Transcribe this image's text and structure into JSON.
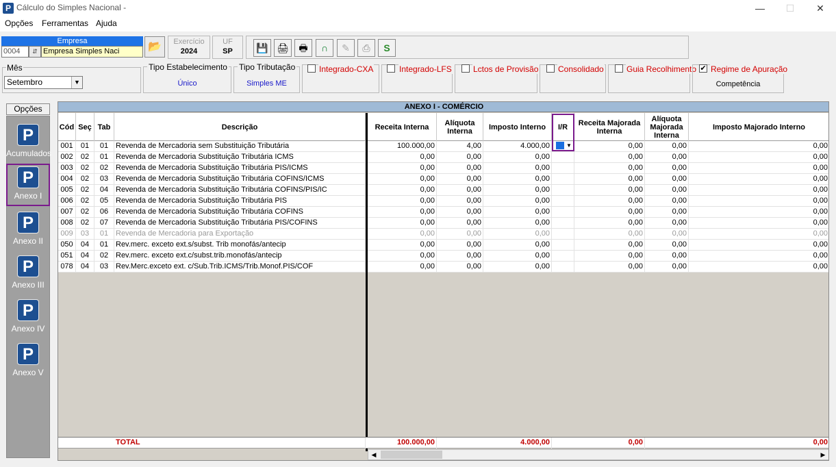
{
  "window": {
    "title": "Cálculo do Simples Nacional -",
    "minimize": "—",
    "maximize": "☐",
    "close": "✕"
  },
  "menu": [
    "Opções",
    "Ferramentas",
    "Ajuda"
  ],
  "empresa": {
    "header": "Empresa",
    "code": "0004",
    "name": "Empresa Simples Naci"
  },
  "exercicio": {
    "label": "Exercício",
    "value": "2024"
  },
  "uf": {
    "label": "UF",
    "value": "SP"
  },
  "tools": [
    "save-icon",
    "print-icon",
    "print-preview-icon",
    "magnet-icon",
    "disabled-icon",
    "scanner-icon",
    "refresh-icon"
  ],
  "filters": {
    "mes": {
      "label": "Mês",
      "value": "Setembro"
    },
    "tipo_estabelecimento": {
      "label": "Tipo Estabelecimento",
      "value": "Único"
    },
    "tipo_tributacao": {
      "label": "Tipo Tributação",
      "value": "Simples ME"
    },
    "checks": [
      {
        "label": "Integrado-CXA",
        "checked": false
      },
      {
        "label": "Integrado-LFS",
        "checked": false
      },
      {
        "label": "Lctos de Provisão",
        "checked": false
      },
      {
        "label": "Consolidado",
        "checked": false
      },
      {
        "label": "Guia Recolhimento",
        "checked": false
      },
      {
        "label": "Regime de Apuração",
        "checked": true,
        "value": "Competência"
      }
    ]
  },
  "nav": {
    "title": "Opções",
    "items": [
      "Acumulados",
      "Anexo I",
      "Anexo II",
      "Anexo III",
      "Anexo IV",
      "Anexo V"
    ],
    "selected": "Anexo I"
  },
  "grid": {
    "title": "ANEXO I - COMÉRCIO",
    "headers": {
      "cod": "Cód",
      "sec": "Seç",
      "tab": "Tab",
      "descricao": "Descrição",
      "receita_interna": "Receita Interna",
      "aliquota_interna": "Alíquota Interna",
      "imposto_interno": "Imposto Interno",
      "ir": "I/R",
      "receita_majorada": "Receita Majorada Interna",
      "aliquota_majorada": "Alíquota Majorada Interna",
      "imposto_majorado": "Imposto Majorado Interno"
    },
    "rows": [
      [
        "001",
        "01",
        "01",
        "Revenda de Mercadoria sem Substituição Tributária",
        "100.000,00",
        "4,00",
        "4.000,00",
        "0,00",
        "0,00",
        "0,00"
      ],
      [
        "002",
        "02",
        "01",
        "Revenda de Mercadoria  Substituição Tributária ICMS",
        "0,00",
        "0,00",
        "0,00",
        "0,00",
        "0,00",
        "0,00"
      ],
      [
        "003",
        "02",
        "02",
        "Revenda de Mercadoria  Substituição Tributária PIS/ICMS",
        "0,00",
        "0,00",
        "0,00",
        "0,00",
        "0,00",
        "0,00"
      ],
      [
        "004",
        "02",
        "03",
        "Revenda de Mercadoria  Substituição Tributária COFINS/ICMS",
        "0,00",
        "0,00",
        "0,00",
        "0,00",
        "0,00",
        "0,00"
      ],
      [
        "005",
        "02",
        "04",
        "Revenda de Mercadoria  Substituição Tributária COFINS/PIS/IC",
        "0,00",
        "0,00",
        "0,00",
        "0,00",
        "0,00",
        "0,00"
      ],
      [
        "006",
        "02",
        "05",
        "Revenda de Mercadoria  Substituição Tributária PIS",
        "0,00",
        "0,00",
        "0,00",
        "0,00",
        "0,00",
        "0,00"
      ],
      [
        "007",
        "02",
        "06",
        "Revenda de Mercadoria  Substituição Tributária COFINS",
        "0,00",
        "0,00",
        "0,00",
        "0,00",
        "0,00",
        "0,00"
      ],
      [
        "008",
        "02",
        "07",
        "Revenda de Mercadoria  Substituição Tributária PIS/COFINS",
        "0,00",
        "0,00",
        "0,00",
        "0,00",
        "0,00",
        "0,00"
      ],
      [
        "009",
        "03",
        "01",
        "Revenda de Mercadoria para Exportação",
        "0,00",
        "0,00",
        "0,00",
        "0,00",
        "0,00",
        "0,00"
      ],
      [
        "050",
        "04",
        "01",
        "Rev.merc. exceto ext.s/subst. Trib monofás/antecip",
        "0,00",
        "0,00",
        "0,00",
        "0,00",
        "0,00",
        "0,00"
      ],
      [
        "051",
        "04",
        "02",
        "Rev.merc. exceto ext.c/subst.trib.monofás/antecip",
        "0,00",
        "0,00",
        "0,00",
        "0,00",
        "0,00",
        "0,00"
      ],
      [
        "078",
        "04",
        "03",
        "Rev.Merc.exceto ext. c/Sub.Trib.ICMS/Trib.Monof.PIS/COF",
        "0,00",
        "0,00",
        "0,00",
        "0,00",
        "0,00",
        "0,00"
      ]
    ],
    "dim_rows": [
      8
    ],
    "total": {
      "label": "TOTAL",
      "receita_interna": "100.000,00",
      "imposto_interno": "4.000,00",
      "receita_majorada": "0,00",
      "imposto_majorado": "0,00"
    }
  }
}
